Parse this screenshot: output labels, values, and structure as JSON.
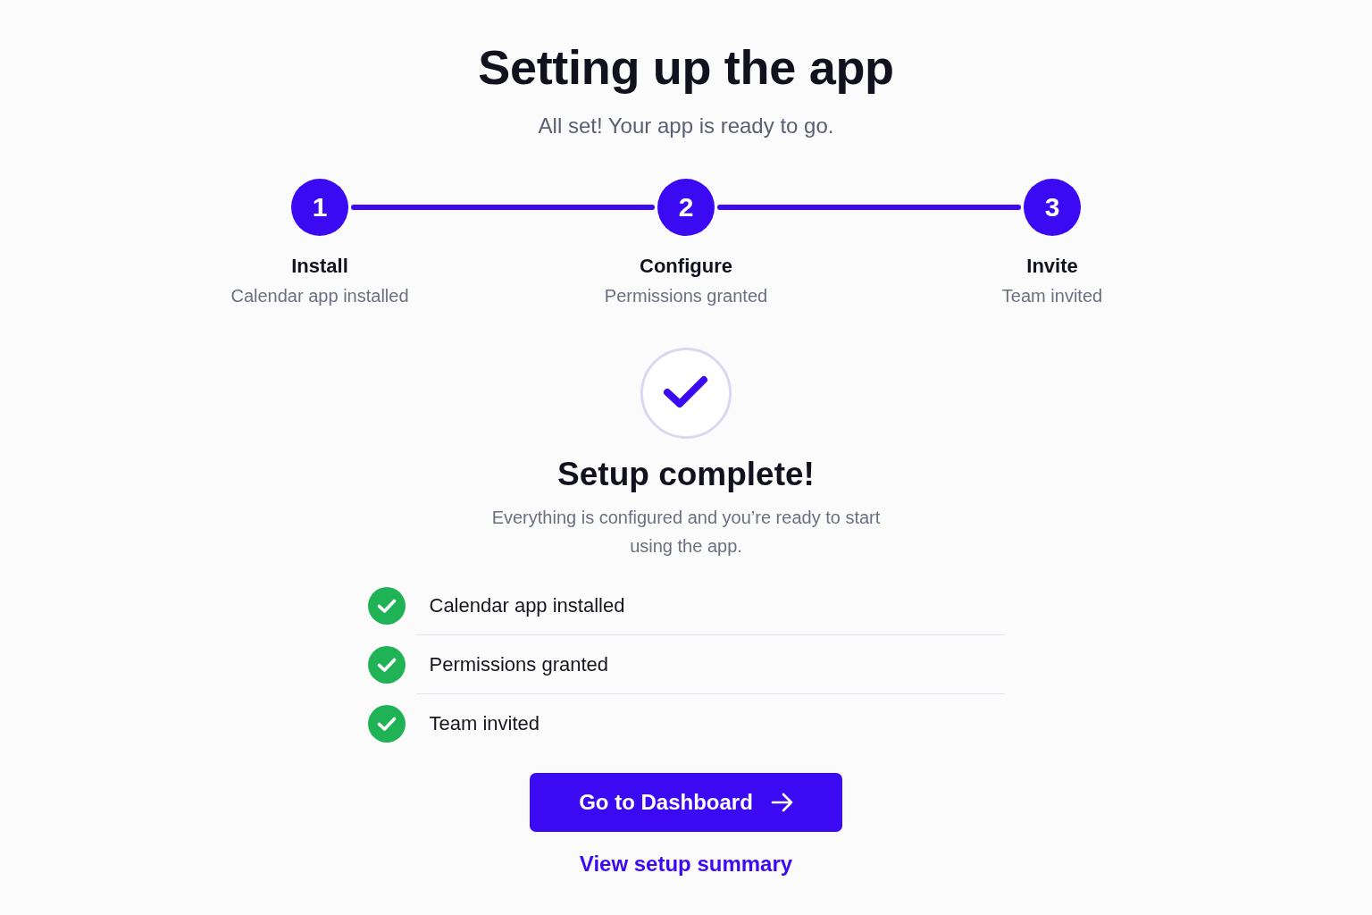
{
  "header": {
    "title": "Setting up the app",
    "subtitle": "All set! Your app is ready to go."
  },
  "steps": [
    {
      "number": "1",
      "label": "Install",
      "detail": "Calendar app installed",
      "completed": true
    },
    {
      "number": "2",
      "label": "Configure",
      "detail": "Permissions granted",
      "completed": true
    },
    {
      "number": "3",
      "label": "Invite",
      "detail": "Team invited",
      "completed": true
    }
  ],
  "completion": {
    "title": "Setup complete!",
    "message": "Everything is configured and you’re ready to start using the app."
  },
  "checklist": [
    {
      "label": "Calendar app installed",
      "done": true
    },
    {
      "label": "Permissions granted",
      "done": true
    },
    {
      "label": "Team invited",
      "done": true
    }
  ],
  "primary_button": {
    "label": "Go to Dashboard"
  },
  "link": {
    "label": "View setup summary"
  }
}
